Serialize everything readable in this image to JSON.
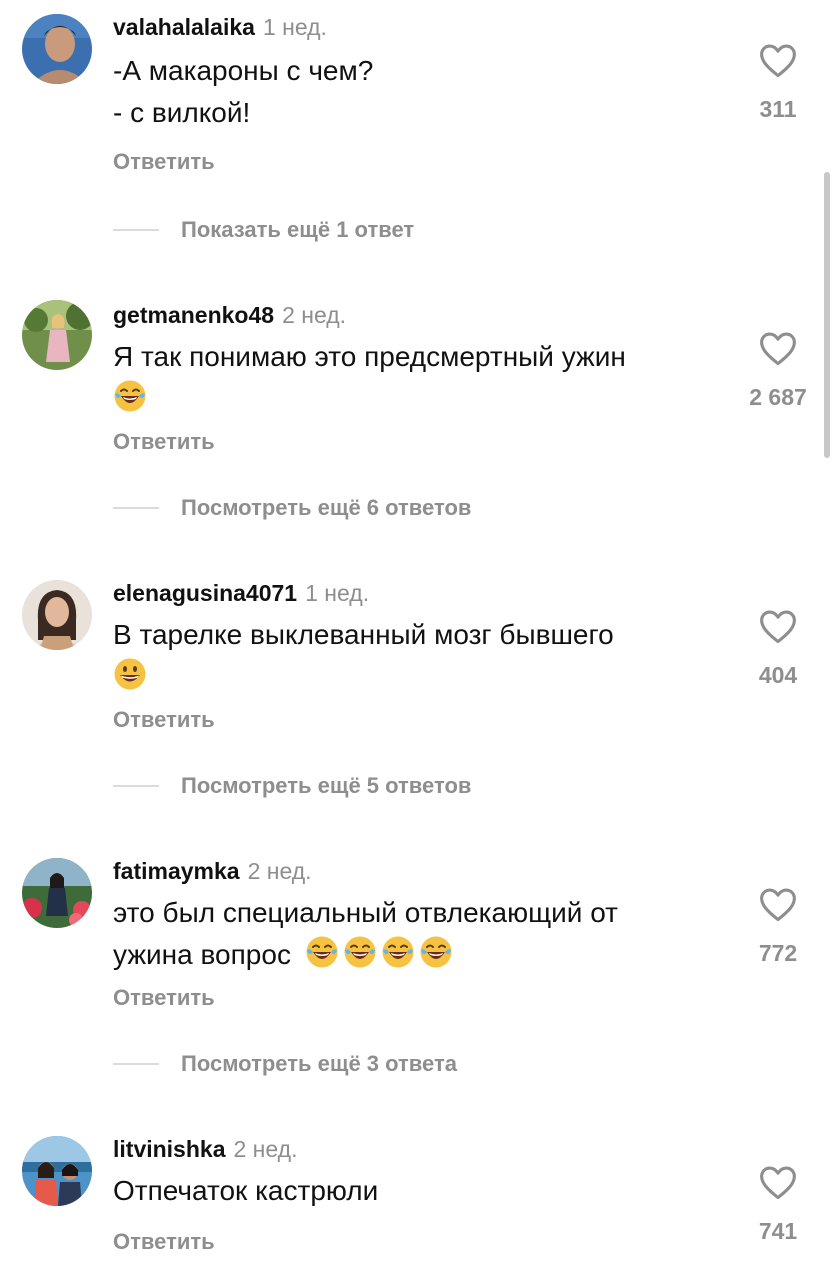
{
  "comments": [
    {
      "username": "valahalalaika",
      "time": "1 нед.",
      "lines": [
        "-А макароны с чем?",
        "- с вилкой!"
      ],
      "emojis": [],
      "reply_label": "Ответить",
      "likes": "311",
      "more_replies": "Показать ещё 1 ответ"
    },
    {
      "username": "getmanenko48",
      "time": "2 нед.",
      "lines": [
        "Я так понимаю это предсмертный ужин"
      ],
      "emojis": [
        "face-with-tears-of-joy"
      ],
      "reply_label": "Ответить",
      "likes": "2 687",
      "more_replies": "Посмотреть ещё 6 ответов"
    },
    {
      "username": "elenagusina4071",
      "time": "1 нед.",
      "lines": [
        "В тарелке выклеванный мозг бывшего"
      ],
      "emojis": [
        "grinning-face"
      ],
      "reply_label": "Ответить",
      "likes": "404",
      "more_replies": "Посмотреть ещё 5 ответов"
    },
    {
      "username": "fatimaymka",
      "time": "2 нед.",
      "lines": [
        "это был специальный отвлекающий от",
        "ужина вопрос"
      ],
      "emojis": [
        "face-with-tears-of-joy",
        "face-with-tears-of-joy",
        "face-with-tears-of-joy",
        "face-with-tears-of-joy"
      ],
      "reply_label": "Ответить",
      "likes": "772",
      "more_replies": "Посмотреть ещё 3 ответа"
    },
    {
      "username": "litvinishka",
      "time": "2 нед.",
      "lines": [
        "Отпечаток кастрюли"
      ],
      "emojis": [],
      "reply_label": "Ответить",
      "likes": "741"
    }
  ],
  "icons": {
    "like": "heart-outline-icon"
  },
  "colors": {
    "background": "#ffffff",
    "text": "#111111",
    "muted": "#8e8e8e",
    "divider": "#dbdbdb",
    "emoji": "#f5c242"
  }
}
